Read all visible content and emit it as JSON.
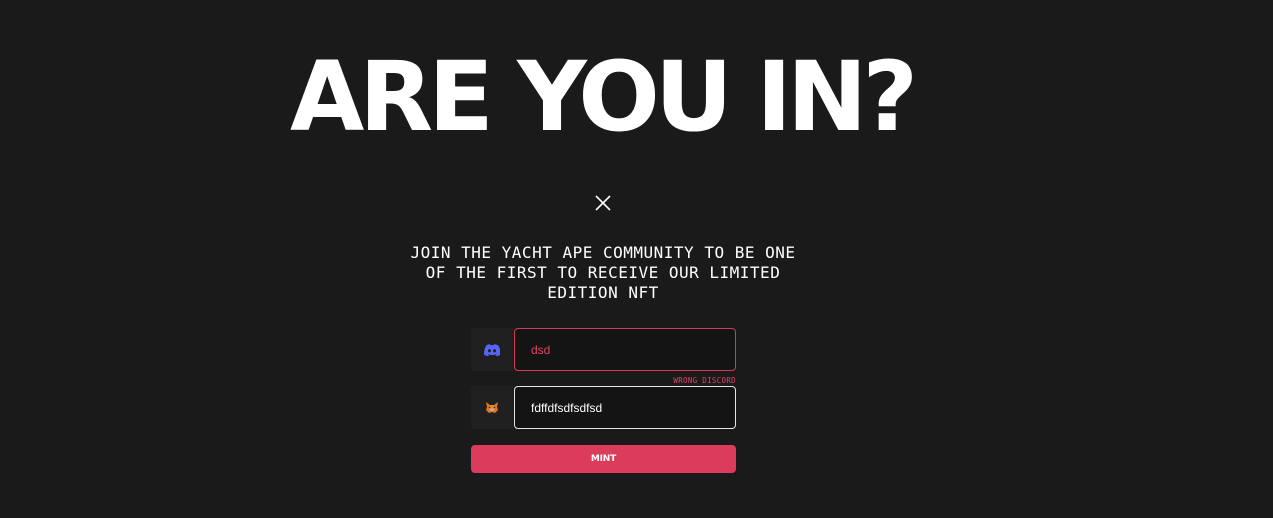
{
  "headline": "ARE YOU IN?",
  "subtitle": "JOIN THE YACHT APE COMMUNITY TO BE ONE OF THE FIRST TO RECEIVE OUR LIMITED EDITION NFT",
  "close_icon": "close-icon",
  "form": {
    "discord": {
      "icon": "discord-icon",
      "value": "dsd",
      "error": "WRONG DISCORD"
    },
    "wallet": {
      "icon": "metamask-fox-icon",
      "value": "fdffdfsdfsdfsd"
    },
    "submit_label": "MINT"
  },
  "colors": {
    "background": "#1a1a1a",
    "accent": "#dc3c5c",
    "error": "#e04462",
    "text": "#ffffff",
    "discord_brand": "#5865f2",
    "metamask_brand": "#e2761b"
  }
}
